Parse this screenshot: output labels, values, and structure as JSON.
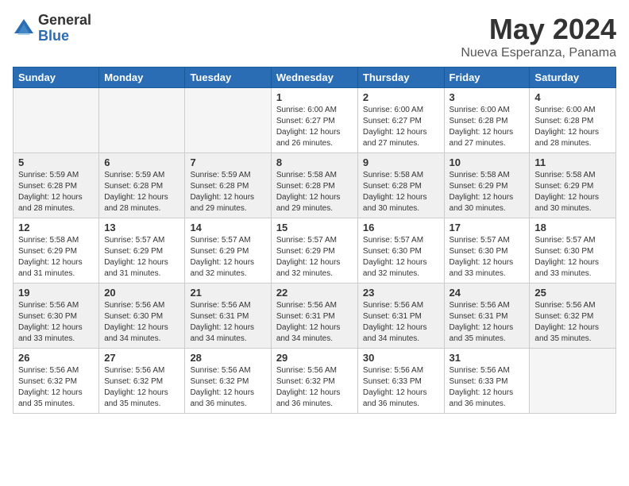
{
  "header": {
    "logo_general": "General",
    "logo_blue": "Blue",
    "title": "May 2024",
    "subtitle": "Nueva Esperanza, Panama"
  },
  "weekdays": [
    "Sunday",
    "Monday",
    "Tuesday",
    "Wednesday",
    "Thursday",
    "Friday",
    "Saturday"
  ],
  "weeks": [
    [
      {
        "day": "",
        "info": ""
      },
      {
        "day": "",
        "info": ""
      },
      {
        "day": "",
        "info": ""
      },
      {
        "day": "1",
        "info": "Sunrise: 6:00 AM\nSunset: 6:27 PM\nDaylight: 12 hours\nand 26 minutes."
      },
      {
        "day": "2",
        "info": "Sunrise: 6:00 AM\nSunset: 6:27 PM\nDaylight: 12 hours\nand 27 minutes."
      },
      {
        "day": "3",
        "info": "Sunrise: 6:00 AM\nSunset: 6:28 PM\nDaylight: 12 hours\nand 27 minutes."
      },
      {
        "day": "4",
        "info": "Sunrise: 6:00 AM\nSunset: 6:28 PM\nDaylight: 12 hours\nand 28 minutes."
      }
    ],
    [
      {
        "day": "5",
        "info": "Sunrise: 5:59 AM\nSunset: 6:28 PM\nDaylight: 12 hours\nand 28 minutes."
      },
      {
        "day": "6",
        "info": "Sunrise: 5:59 AM\nSunset: 6:28 PM\nDaylight: 12 hours\nand 28 minutes."
      },
      {
        "day": "7",
        "info": "Sunrise: 5:59 AM\nSunset: 6:28 PM\nDaylight: 12 hours\nand 29 minutes."
      },
      {
        "day": "8",
        "info": "Sunrise: 5:58 AM\nSunset: 6:28 PM\nDaylight: 12 hours\nand 29 minutes."
      },
      {
        "day": "9",
        "info": "Sunrise: 5:58 AM\nSunset: 6:28 PM\nDaylight: 12 hours\nand 30 minutes."
      },
      {
        "day": "10",
        "info": "Sunrise: 5:58 AM\nSunset: 6:29 PM\nDaylight: 12 hours\nand 30 minutes."
      },
      {
        "day": "11",
        "info": "Sunrise: 5:58 AM\nSunset: 6:29 PM\nDaylight: 12 hours\nand 30 minutes."
      }
    ],
    [
      {
        "day": "12",
        "info": "Sunrise: 5:58 AM\nSunset: 6:29 PM\nDaylight: 12 hours\nand 31 minutes."
      },
      {
        "day": "13",
        "info": "Sunrise: 5:57 AM\nSunset: 6:29 PM\nDaylight: 12 hours\nand 31 minutes."
      },
      {
        "day": "14",
        "info": "Sunrise: 5:57 AM\nSunset: 6:29 PM\nDaylight: 12 hours\nand 32 minutes."
      },
      {
        "day": "15",
        "info": "Sunrise: 5:57 AM\nSunset: 6:29 PM\nDaylight: 12 hours\nand 32 minutes."
      },
      {
        "day": "16",
        "info": "Sunrise: 5:57 AM\nSunset: 6:30 PM\nDaylight: 12 hours\nand 32 minutes."
      },
      {
        "day": "17",
        "info": "Sunrise: 5:57 AM\nSunset: 6:30 PM\nDaylight: 12 hours\nand 33 minutes."
      },
      {
        "day": "18",
        "info": "Sunrise: 5:57 AM\nSunset: 6:30 PM\nDaylight: 12 hours\nand 33 minutes."
      }
    ],
    [
      {
        "day": "19",
        "info": "Sunrise: 5:56 AM\nSunset: 6:30 PM\nDaylight: 12 hours\nand 33 minutes."
      },
      {
        "day": "20",
        "info": "Sunrise: 5:56 AM\nSunset: 6:30 PM\nDaylight: 12 hours\nand 34 minutes."
      },
      {
        "day": "21",
        "info": "Sunrise: 5:56 AM\nSunset: 6:31 PM\nDaylight: 12 hours\nand 34 minutes."
      },
      {
        "day": "22",
        "info": "Sunrise: 5:56 AM\nSunset: 6:31 PM\nDaylight: 12 hours\nand 34 minutes."
      },
      {
        "day": "23",
        "info": "Sunrise: 5:56 AM\nSunset: 6:31 PM\nDaylight: 12 hours\nand 34 minutes."
      },
      {
        "day": "24",
        "info": "Sunrise: 5:56 AM\nSunset: 6:31 PM\nDaylight: 12 hours\nand 35 minutes."
      },
      {
        "day": "25",
        "info": "Sunrise: 5:56 AM\nSunset: 6:32 PM\nDaylight: 12 hours\nand 35 minutes."
      }
    ],
    [
      {
        "day": "26",
        "info": "Sunrise: 5:56 AM\nSunset: 6:32 PM\nDaylight: 12 hours\nand 35 minutes."
      },
      {
        "day": "27",
        "info": "Sunrise: 5:56 AM\nSunset: 6:32 PM\nDaylight: 12 hours\nand 35 minutes."
      },
      {
        "day": "28",
        "info": "Sunrise: 5:56 AM\nSunset: 6:32 PM\nDaylight: 12 hours\nand 36 minutes."
      },
      {
        "day": "29",
        "info": "Sunrise: 5:56 AM\nSunset: 6:32 PM\nDaylight: 12 hours\nand 36 minutes."
      },
      {
        "day": "30",
        "info": "Sunrise: 5:56 AM\nSunset: 6:33 PM\nDaylight: 12 hours\nand 36 minutes."
      },
      {
        "day": "31",
        "info": "Sunrise: 5:56 AM\nSunset: 6:33 PM\nDaylight: 12 hours\nand 36 minutes."
      },
      {
        "day": "",
        "info": ""
      }
    ]
  ]
}
